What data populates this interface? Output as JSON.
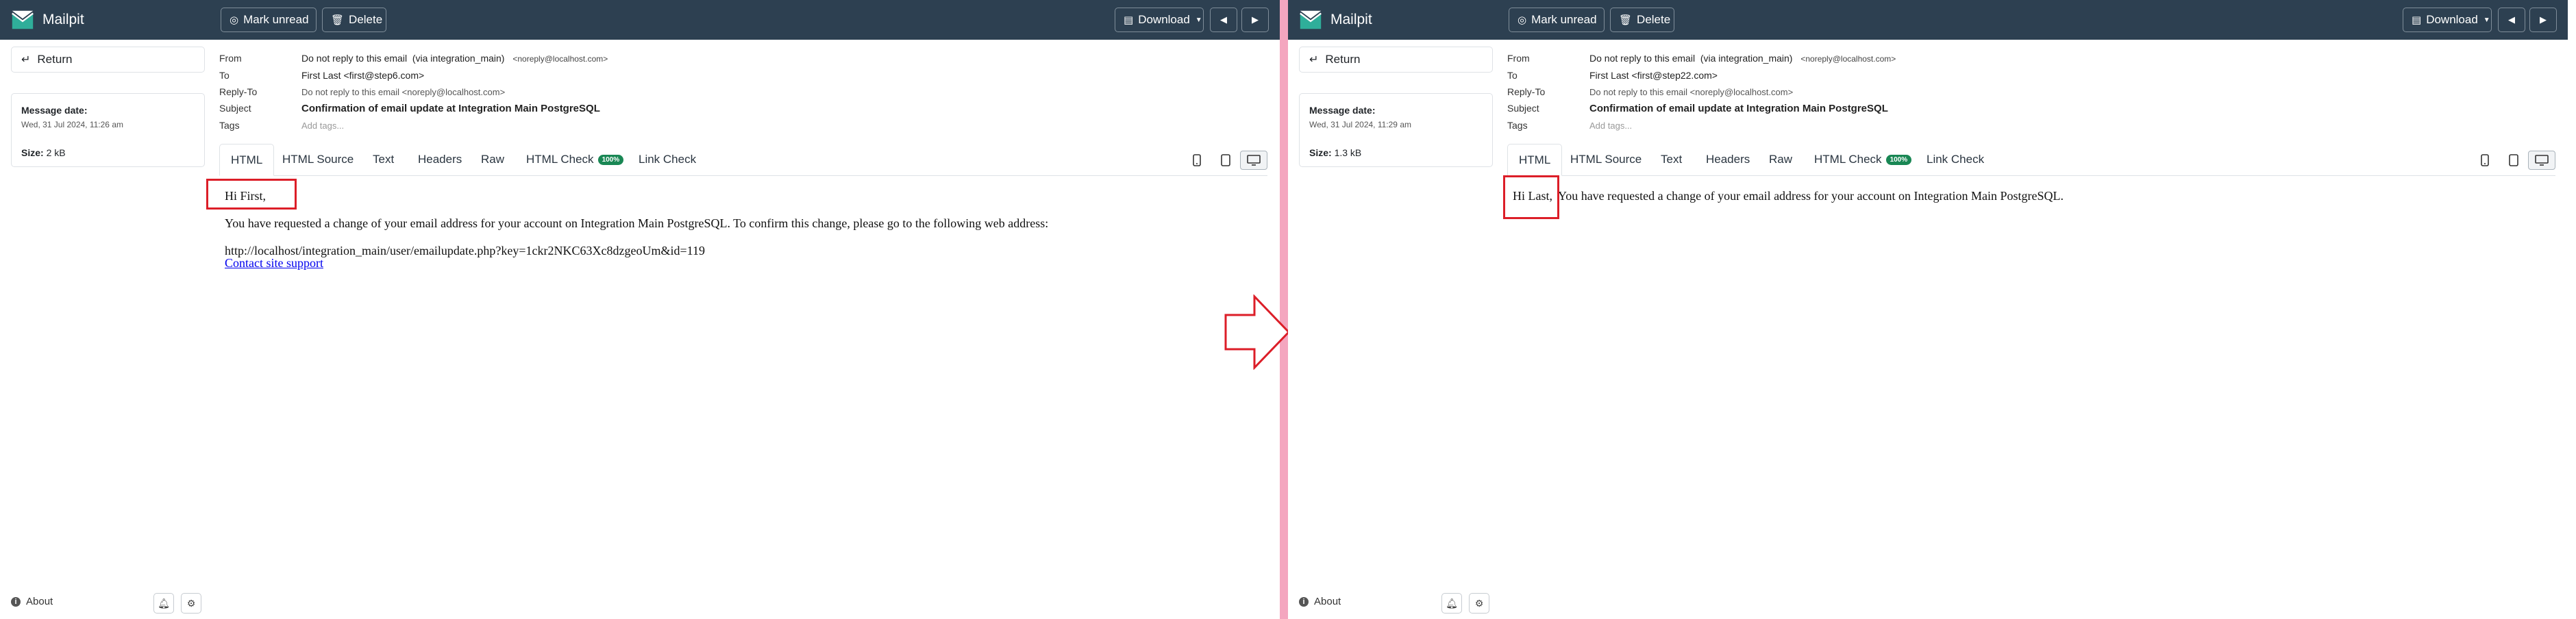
{
  "left": {
    "app_name": "Mailpit",
    "toolbar": {
      "mark_unread_label": "Mark unread",
      "delete_label": "Delete",
      "download_label": "Download"
    },
    "sidebar": {
      "return_label": "Return",
      "message_date_label": "Message date:",
      "message_date_value": "Wed, 31 Jul 2024, 11:26 am",
      "size_label": "Size:",
      "size_value": "2 kB",
      "about_label": "About"
    },
    "headers": {
      "from_label": "From",
      "from_value": "Do not reply to this email  (via integration_main)",
      "from_email": "<noreply@localhost.com>",
      "to_label": "To",
      "to_value": "First Last <first@step6.com>",
      "reply_to_label": "Reply-To",
      "reply_to_value": "Do not reply to this email <noreply@localhost.com>",
      "subject_label": "Subject",
      "subject_value": "Confirmation of email update at Integration Main PostgreSQL",
      "tags_label": "Tags",
      "tags_placeholder": "Add tags..."
    },
    "tabs": {
      "html": "HTML",
      "html_source": "HTML Source",
      "text": "Text",
      "headers": "Headers",
      "raw": "Raw",
      "html_check": "HTML Check",
      "html_check_badge": "100%",
      "link_check": "Link Check"
    },
    "email": {
      "greeting": "Hi First,",
      "line1": "You have requested a change of your email address for your account on Integration Main PostgreSQL. To confirm this change, please go to the following web address:",
      "url": "http://localhost/integration_main/user/emailupdate.php?key=1ckr2NKC63Xc8dzgeoUm&id=119",
      "support_link": "Contact site support"
    }
  },
  "right": {
    "app_name": "Mailpit",
    "toolbar": {
      "mark_unread_label": "Mark unread",
      "delete_label": "Delete",
      "download_label": "Download"
    },
    "sidebar": {
      "return_label": "Return",
      "message_date_label": "Message date:",
      "message_date_value": "Wed, 31 Jul 2024, 11:29 am",
      "size_label": "Size:",
      "size_value": "1.3 kB",
      "about_label": "About"
    },
    "headers": {
      "from_label": "From",
      "from_value": "Do not reply to this email  (via integration_main)",
      "from_email": "<noreply@localhost.com>",
      "to_label": "To",
      "to_value": "First Last <first@step22.com>",
      "reply_to_label": "Reply-To",
      "reply_to_value": "Do not reply to this email <noreply@localhost.com>",
      "subject_label": "Subject",
      "subject_value": "Confirmation of email update at Integration Main PostgreSQL",
      "tags_label": "Tags",
      "tags_placeholder": "Add tags..."
    },
    "tabs": {
      "html": "HTML",
      "html_source": "HTML Source",
      "text": "Text",
      "headers": "Headers",
      "raw": "Raw",
      "html_check": "HTML Check",
      "html_check_badge": "100%",
      "link_check": "Link Check"
    },
    "email": {
      "greeting": "Hi Last,",
      "line1": "You have requested a change of your email address for your account on Integration Main PostgreSQL."
    }
  },
  "colors": {
    "navbar": "#2d4051",
    "annotation": "#dc1e28",
    "divider": "#f4a6bf",
    "badge": "#198754"
  },
  "icons": {
    "logo": "mailpit-logo-icon",
    "mark_unread": "eye-slash-icon",
    "delete": "trash-icon",
    "download": "file-download-icon",
    "prev": "chevron-left-icon",
    "next": "chevron-right-icon",
    "return": "return-arrow-icon",
    "about": "info-icon",
    "bell": "bell-icon",
    "settings": "gear-icon",
    "phone": "phone-icon",
    "tablet": "tablet-icon",
    "desktop": "desktop-icon",
    "comparison_arrow": "right-arrow-icon"
  }
}
